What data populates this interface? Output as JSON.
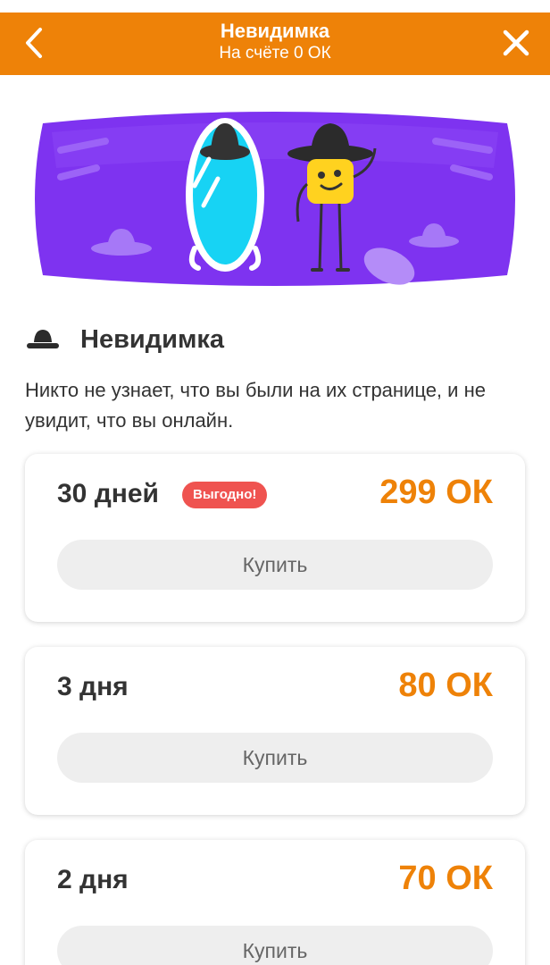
{
  "header": {
    "title": "Невидимка",
    "balance": "На счёте 0 ОК"
  },
  "feature": {
    "name": "Невидимка",
    "description": "Никто не узнает, что вы были на их странице, и не увидит, что вы онлайн."
  },
  "plans": [
    {
      "period": "30 дней",
      "badge": "Выгодно!",
      "price": "299 ОК",
      "buy_label": "Купить"
    },
    {
      "period": "3 дня",
      "price": "80 ОК",
      "buy_label": "Купить"
    },
    {
      "period": "2 дня",
      "price": "70 ОК",
      "buy_label": "Купить"
    }
  ],
  "colors": {
    "accent": "#ee8208",
    "badge": "#ef5350",
    "banner": "#7e33f0"
  },
  "icons": [
    "back-arrow-icon",
    "close-icon",
    "hat-icon",
    "invisibility-banner-illustration"
  ]
}
